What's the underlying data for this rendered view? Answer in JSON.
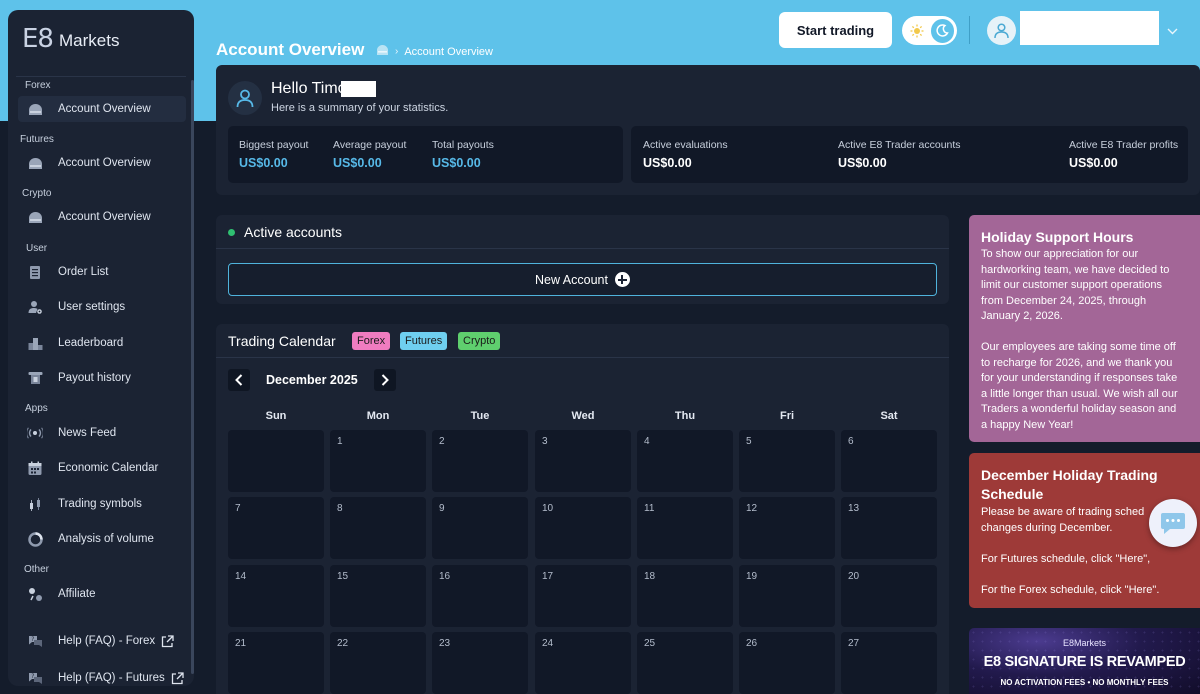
{
  "brand": {
    "mark": "E8",
    "name": "Markets"
  },
  "sidebar": {
    "sections": [
      {
        "title": "Forex",
        "items": [
          {
            "label": "Account Overview",
            "icon": "account-icon"
          }
        ]
      },
      {
        "title": "Futures",
        "items": [
          {
            "label": "Account Overview",
            "icon": "account-icon"
          }
        ]
      },
      {
        "title": "Crypto",
        "items": [
          {
            "label": "Account Overview",
            "icon": "account-icon"
          }
        ]
      },
      {
        "title": "User",
        "items": [
          {
            "label": "Order List",
            "icon": "list-icon"
          },
          {
            "label": "User settings",
            "icon": "user-settings-icon"
          },
          {
            "label": "Leaderboard",
            "icon": "leaderboard-icon"
          },
          {
            "label": "Payout history",
            "icon": "payout-icon"
          }
        ]
      },
      {
        "title": "Apps",
        "items": [
          {
            "label": "News Feed",
            "icon": "broadcast-icon"
          },
          {
            "label": "Economic Calendar",
            "icon": "calendar-icon"
          },
          {
            "label": "Trading symbols",
            "icon": "candlestick-icon"
          },
          {
            "label": "Analysis of volume",
            "icon": "pie-chart-icon"
          }
        ]
      },
      {
        "title": "Other",
        "items": [
          {
            "label": "Affiliate",
            "icon": "affiliate-icon"
          },
          {
            "label": "Help (FAQ) - Forex",
            "icon": "help-icon"
          },
          {
            "label": "Help (FAQ) - Futures",
            "icon": "help-icon"
          }
        ]
      }
    ]
  },
  "header": {
    "title": "Account Overview",
    "breadcrumb": "Account Overview",
    "start_trading": "Start trading"
  },
  "summary": {
    "greeting": "Hello Timo",
    "subtitle": "Here is a summary of your statistics.",
    "payouts": [
      {
        "label": "Biggest payout",
        "value": "US$0.00"
      },
      {
        "label": "Average payout",
        "value": "US$0.00"
      },
      {
        "label": "Total payouts",
        "value": "US$0.00"
      }
    ],
    "accounts": [
      {
        "label": "Active evaluations",
        "value": "US$0.00"
      },
      {
        "label": "Active E8 Trader accounts",
        "value": "US$0.00"
      },
      {
        "label": "Active E8 Trader profits",
        "value": "US$0.00"
      }
    ]
  },
  "active_accounts": {
    "title": "Active accounts",
    "new_account": "New Account"
  },
  "calendar": {
    "title": "Trading Calendar",
    "tags": [
      {
        "label": "Forex",
        "color": "#f07cc0"
      },
      {
        "label": "Futures",
        "color": "#6fcff0"
      },
      {
        "label": "Crypto",
        "color": "#5fcf6e"
      }
    ],
    "month": "December 2025",
    "weekdays": [
      "Sun",
      "Mon",
      "Tue",
      "Wed",
      "Thu",
      "Fri",
      "Sat"
    ],
    "weeks": [
      [
        "",
        "1",
        "2",
        "3",
        "4",
        "5",
        "6"
      ],
      [
        "7",
        "8",
        "9",
        "10",
        "11",
        "12",
        "13"
      ],
      [
        "14",
        "15",
        "16",
        "17",
        "18",
        "19",
        "20"
      ],
      [
        "21",
        "22",
        "23",
        "24",
        "25",
        "26",
        "27"
      ]
    ]
  },
  "notices": {
    "holiday_support": {
      "title": "Holiday Support Hours",
      "body": "To show our appreciation for our\nhardworking team, we have decided to\nlimit our customer support operations\nfrom December 24, 2025, through\nJanuary 2, 2026.\n\nOur employees are taking some time off\nto recharge for 2026, and we thank you\nfor your understanding if responses take\na little longer than usual. We wish all our\nTraders a wonderful holiday season and\na happy New Year!"
    },
    "holiday_schedule": {
      "title": "December Holiday Trading\nSchedule",
      "body": "Please be aware of trading sched\nchanges during December.\n\nFor Futures schedule, click \"Here\",\n\nFor the Forex schedule, click \"Here\"."
    }
  },
  "banner": {
    "brand": "E8Markets",
    "headline": "E8 SIGNATURE IS REVAMPED",
    "features": "NO ACTIVATION FEES   •   NO MONTHLY FEES"
  },
  "colors": {
    "accent": "#57b9e8",
    "top_band": "#5ec2ea",
    "panel": "#1b2333",
    "purple_card": "#a36697",
    "red_card": "#9e3a38"
  }
}
